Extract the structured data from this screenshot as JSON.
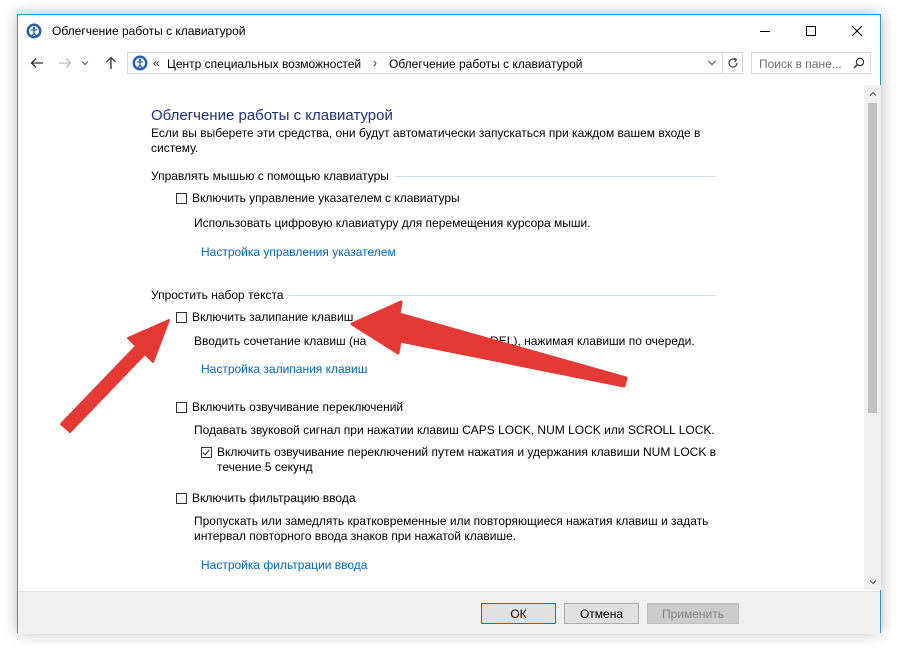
{
  "window": {
    "title": "Облегчение работы с клавиатурой",
    "controls": {
      "minimize": "minimize",
      "maximize": "maximize",
      "close": "close"
    }
  },
  "nav": {
    "address_sep": "«",
    "crumbs": [
      "Центр специальных возможностей",
      "Облегчение работы с клавиатурой"
    ],
    "crumb_sep": "›",
    "search_placeholder": "Поиск в пане..."
  },
  "page": {
    "title": "Облегчение работы с клавиатурой",
    "intro": "Если вы выберете эти средства, они будут автоматически запускаться при каждом вашем входе в систему.",
    "section_mouse": {
      "heading": "Управлять мышью с помощью клавиатуры",
      "checkbox_label": "Включить управление указателем с клавиатуры",
      "checked": false,
      "description": "Использовать цифровую клавиатуру для перемещения курсора мыши.",
      "link": "Настройка управления указателем"
    },
    "section_typing": {
      "heading": "Упростить набор текста",
      "sticky": {
        "checkbox_label": "Включить залипание клавиш",
        "checked": false,
        "description_left": "Вводить сочетание клавиш (на",
        "description_right": "ALT+DEL), нажимая клавиши по очереди.",
        "link": "Настройка залипания клавиш"
      },
      "toggle": {
        "checkbox_label": "Включить озвучивание переключений",
        "checked": false,
        "description": "Подавать звуковой сигнал при нажатии клавиш CAPS LOCK, NUM LOCK или SCROLL LOCK.",
        "sub_checkbox_label_1": "Включить озвучивание переключений путем нажатия и удержания клавиши NUM LOCK в",
        "sub_checkbox_label_2": "течение 5 секунд",
        "sub_checked": true
      },
      "filter": {
        "checkbox_label": "Включить фильтрацию ввода",
        "checked": false,
        "description_1": "Пропускать или замедлять кратковременные или повторяющиеся нажатия клавиш и задать",
        "description_2": "интервал повторного ввода знаков при нажатой клавише.",
        "link": "Настройка фильтрации ввода"
      }
    }
  },
  "footer": {
    "ok": "ОК",
    "cancel": "Отмена",
    "apply": "Применить"
  },
  "colors": {
    "accent": "#2b9bd6",
    "title": "#1e3287",
    "link": "#0066cc",
    "arrow": "#e53935"
  }
}
